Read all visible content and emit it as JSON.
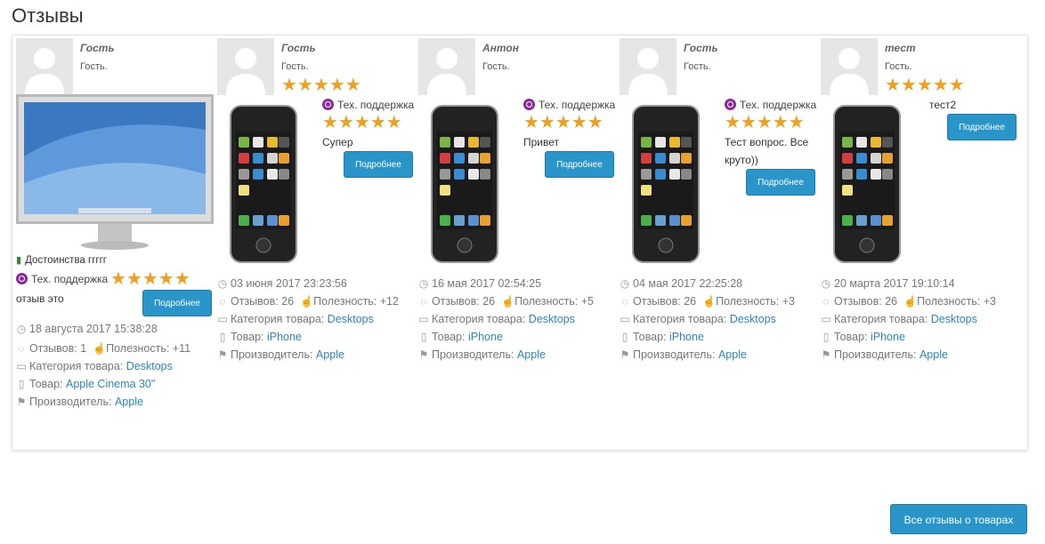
{
  "page": {
    "title": "Отзывы"
  },
  "footer": {
    "all_reviews_button": "Все отзывы о товарах"
  },
  "labels": {
    "more": "Подробнее",
    "support": "Тех. поддержка",
    "reviews": "Отзывов:",
    "usefulness": "Полезность:",
    "category": "Категория товара:",
    "product": "Товар:",
    "manufacturer": "Производитель:",
    "stars": "★★★★★"
  },
  "icons": {
    "clock": "clock-icon",
    "comment": "comment-icon",
    "thumb": "thumbs-up-icon",
    "folder": "folder-icon",
    "file": "file-icon",
    "flag": "flag-icon",
    "gear": "gear-icon"
  },
  "colors": {
    "star": "#f0a020",
    "button": "#2a95c8",
    "link": "#2a87c2",
    "support": "#8a2a9a"
  },
  "reviews": [
    {
      "author": "Гость",
      "role": "Гость.",
      "rating": 5,
      "pros": "Достоинства ггггг",
      "text": "отзыв это",
      "date": "18 августа 2017 15:38:28",
      "reviews_count": "1",
      "usefulness": "+11",
      "category": "Desktops",
      "product": "Apple Cinema 30\"",
      "manufacturer": "Apple"
    },
    {
      "author": "Гость",
      "role": "Гость.",
      "rating": 5,
      "answer": "Супер",
      "date": "03 июня 2017 23:23:56",
      "reviews_count": "26",
      "usefulness": "+12",
      "category": "Desktops",
      "product": "iPhone",
      "manufacturer": "Apple"
    },
    {
      "author": "Антон",
      "role": "Гость.",
      "rating": 5,
      "answer": "Привет",
      "date": "16 мая 2017 02:54:25",
      "reviews_count": "26",
      "usefulness": "+5",
      "category": "Desktops",
      "product": "iPhone",
      "manufacturer": "Apple"
    },
    {
      "author": "Гость",
      "role": "Гость.",
      "rating": 5,
      "answer": "Тест вопрос. Все круто))",
      "date": "04 мая 2017 22:25:28",
      "reviews_count": "26",
      "usefulness": "+3",
      "category": "Desktops",
      "product": "iPhone",
      "manufacturer": "Apple"
    },
    {
      "author": "тест",
      "role": "Гость.",
      "rating": 5,
      "text": "тест2",
      "date": "20 марта 2017 19:10:14",
      "reviews_count": "26",
      "usefulness": "+3",
      "category": "Desktops",
      "product": "iPhone",
      "manufacturer": "Apple"
    }
  ]
}
